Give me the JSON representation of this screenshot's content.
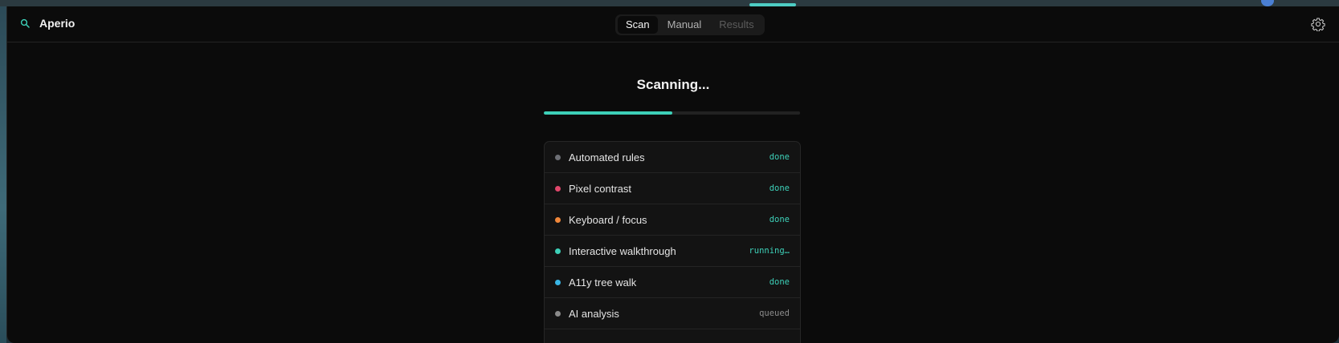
{
  "app": {
    "name": "Aperio",
    "icons": {
      "brand": "magnifier-icon",
      "settings": "gear-icon"
    }
  },
  "tabs": [
    {
      "label": "Scan",
      "state": "active"
    },
    {
      "label": "Manual",
      "state": "normal"
    },
    {
      "label": "Results",
      "state": "disabled"
    }
  ],
  "scan": {
    "title": "Scanning...",
    "progress": 0.5,
    "steps": [
      {
        "label": "Automated rules",
        "status": "done",
        "color": "#6d6f75"
      },
      {
        "label": "Pixel contrast",
        "status": "done",
        "color": "#e0476b"
      },
      {
        "label": "Keyboard / focus",
        "status": "done",
        "color": "#f0873a"
      },
      {
        "label": "Interactive walkthrough",
        "status": "running…",
        "color": "#3dd0b8"
      },
      {
        "label": "A11y tree walk",
        "status": "done",
        "color": "#39b6e6"
      },
      {
        "label": "AI analysis",
        "status": "queued",
        "color": "#8a8a8a"
      }
    ]
  },
  "colors": {
    "accent": "#3dd0b8",
    "background": "#0b0b0b"
  }
}
